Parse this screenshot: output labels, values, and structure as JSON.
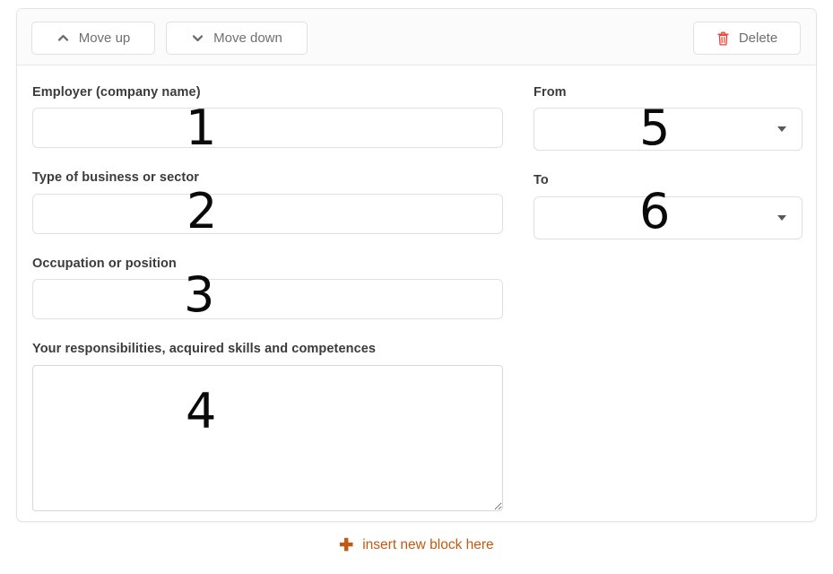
{
  "toolbar": {
    "move_up_label": "Move up",
    "move_down_label": "Move down",
    "delete_label": "Delete",
    "move_up_icon": "chevron-up-icon",
    "move_down_icon": "chevron-down-icon",
    "delete_icon": "trash-icon",
    "delete_icon_color": "#ef4136"
  },
  "form": {
    "left_column": {
      "employer": {
        "label": "Employer (company name)",
        "value": "",
        "placeholder": "",
        "annotation": "1"
      },
      "business_type": {
        "label": "Type of business or sector",
        "value": "",
        "placeholder": "",
        "annotation": "2"
      },
      "occupation": {
        "label": "Occupation or position",
        "value": "",
        "placeholder": "",
        "annotation": "3"
      },
      "responsibilities": {
        "label": "Your responsibilities, acquired skills and competences",
        "value": "",
        "placeholder": "",
        "annotation": "4"
      }
    },
    "right_column": {
      "from": {
        "label": "From",
        "value": "",
        "annotation": "5",
        "arrow_icon": "chevron-down-icon"
      },
      "to": {
        "label": "To",
        "value": "",
        "annotation": "6",
        "arrow_icon": "chevron-down-icon"
      }
    }
  },
  "footer": {
    "insert_label": "insert new block here",
    "insert_icon": "plus-icon",
    "accent_color": "#c05a12"
  }
}
